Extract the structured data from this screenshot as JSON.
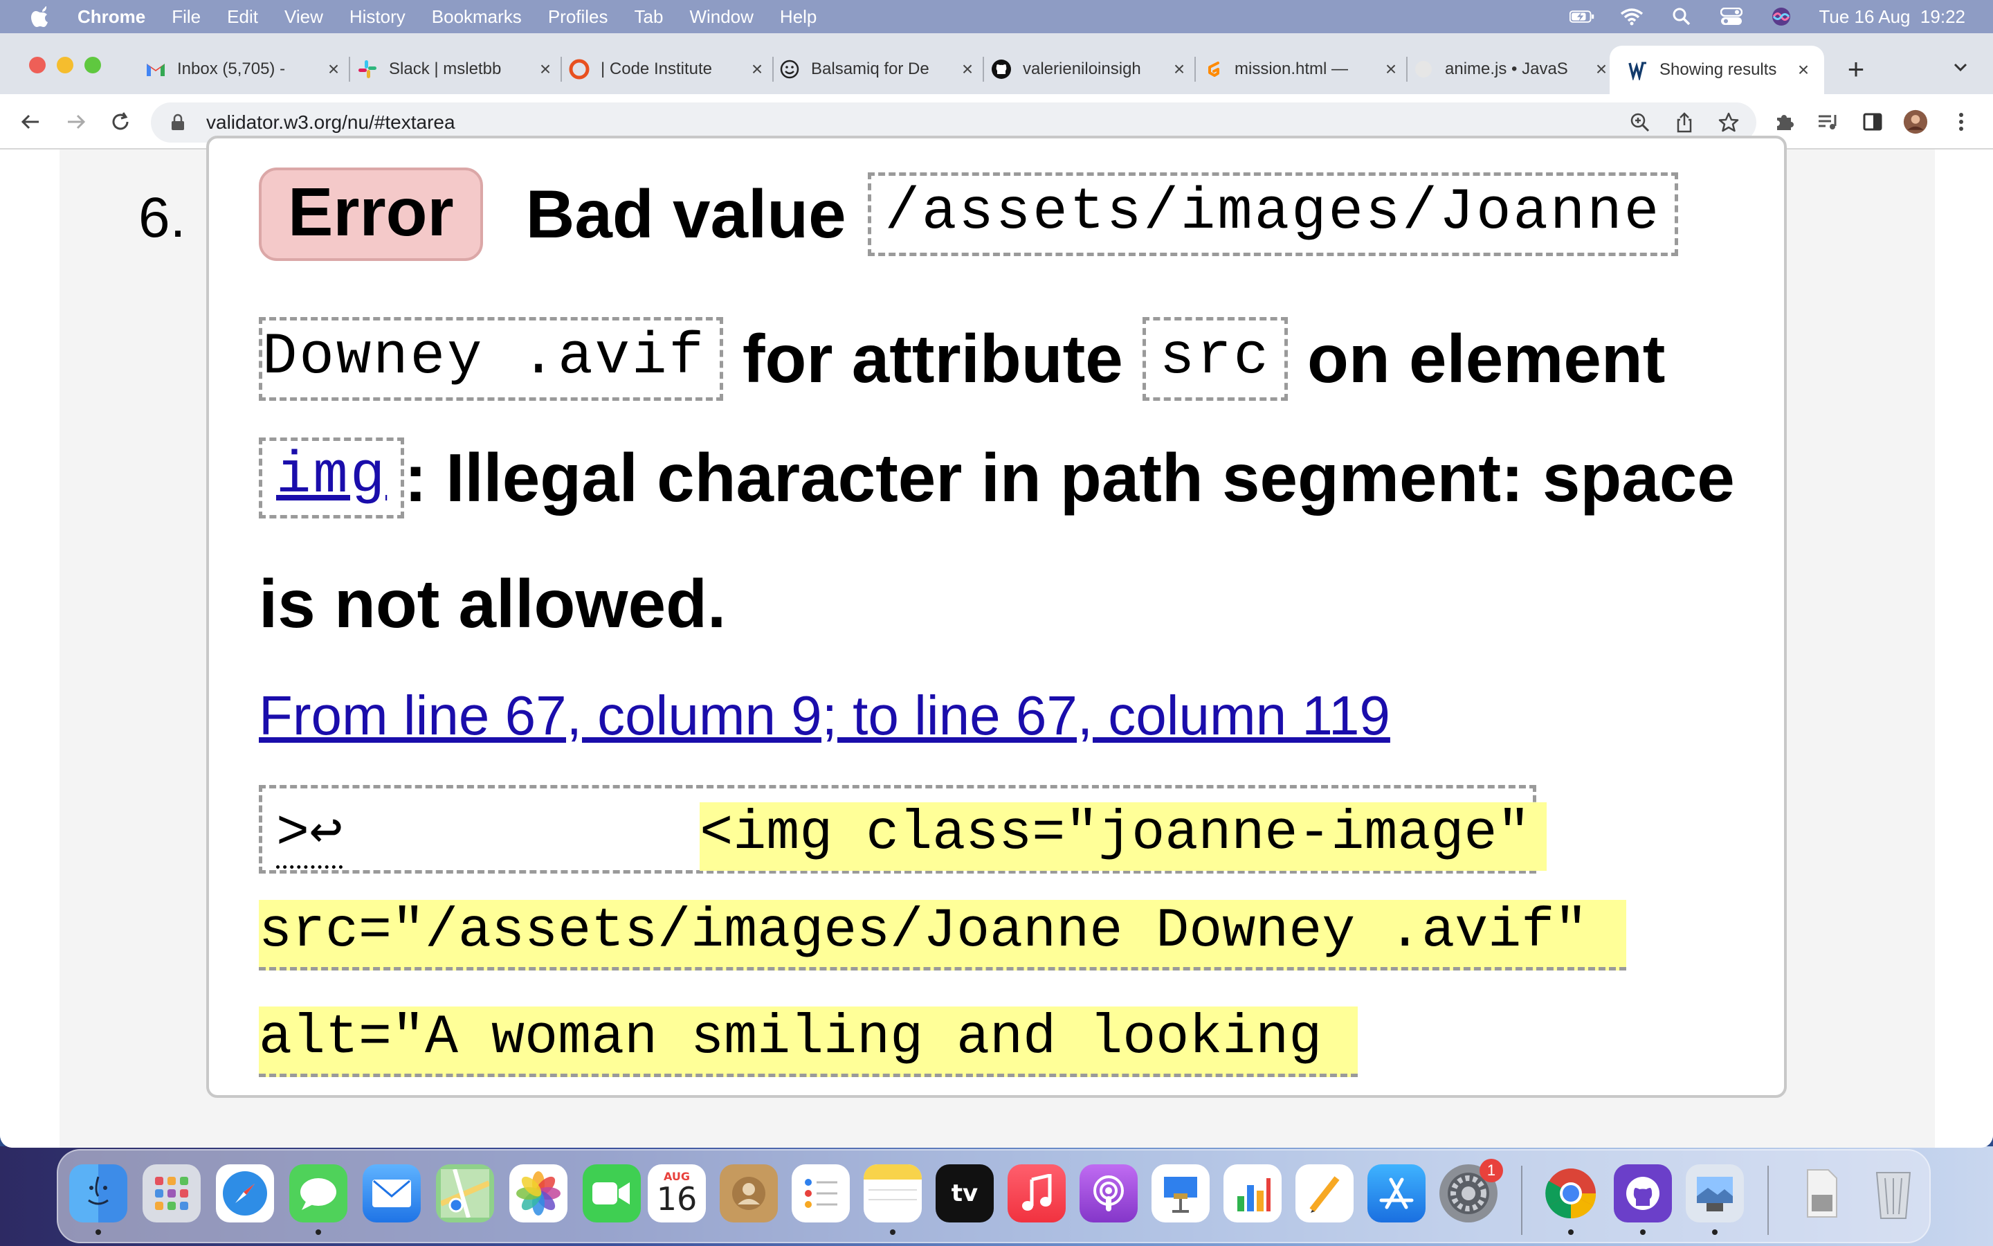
{
  "menubar": {
    "app": "Chrome",
    "items": [
      "File",
      "Edit",
      "View",
      "History",
      "Bookmarks",
      "Profiles",
      "Tab",
      "Window",
      "Help"
    ],
    "clock": "Tue 16 Aug  19:22"
  },
  "tabs": [
    {
      "title": "Inbox (5,705) -",
      "icon": "gmail-icon"
    },
    {
      "title": "Slack | msletbb",
      "icon": "slack-icon"
    },
    {
      "title": "| Code Institute",
      "icon": "code-institute-icon"
    },
    {
      "title": "Balsamiq for De",
      "icon": "balsamiq-icon"
    },
    {
      "title": "valerieniloinsigh",
      "icon": "github-icon"
    },
    {
      "title": "mission.html —",
      "icon": "gitpod-icon"
    },
    {
      "title": "anime.js • JavaS",
      "icon": "anime-icon"
    },
    {
      "title": "Showing results",
      "icon": "w3c-icon",
      "active": true
    }
  ],
  "address": {
    "url": "validator.w3.org/nu/#textarea"
  },
  "message": {
    "number": "6.",
    "badge": "Error",
    "text_bad_value": "Bad value",
    "code_value_part1": "/assets/images/Joanne",
    "code_value_part2": "Downey .avif",
    "text_for_attribute": "for attribute",
    "code_attr": "src",
    "text_on_element": "on element",
    "code_element": "img",
    "text_illegal": ": Illegal character in path segment: space",
    "text_not_allowed": "is not allowed.",
    "location_link": "From line 67, column 9; to line 67, column 119",
    "extract_prefix": ">↩",
    "extract_line1": "<img class=\"joanne-image\"",
    "extract_line2": "src=\"/assets/images/Joanne Downey .avif\"",
    "extract_line3": "alt=\"A woman smiling and looking"
  },
  "dock": {
    "calendar_month": "AUG",
    "calendar_day": "16",
    "tv_label": "tv",
    "settings_badge": "1",
    "apps": [
      "finder",
      "launchpad",
      "safari",
      "messages",
      "mail",
      "maps",
      "photos",
      "facetime",
      "calendar",
      "contacts",
      "reminders",
      "notes",
      "apple-tv",
      "music",
      "podcasts",
      "keynote",
      "numbers",
      "pages",
      "app-store",
      "system-preferences",
      "chrome",
      "github-desktop",
      "preview",
      "documents",
      "trash"
    ]
  }
}
